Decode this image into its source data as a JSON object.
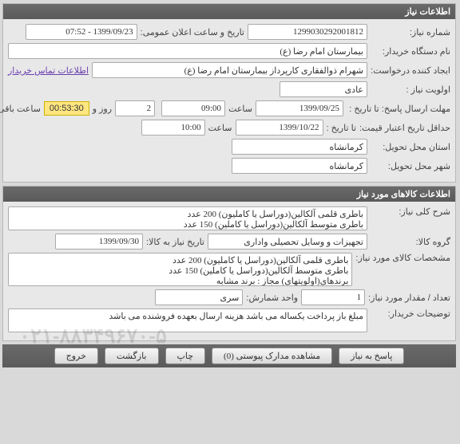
{
  "panels": {
    "need_info": {
      "title": "اطلاعات نیاز",
      "need_number_label": "شماره نیاز:",
      "need_number": "1299030292001812",
      "announce_label": "تاریخ و ساعت اعلان عمومی:",
      "announce_value": "1399/09/23 - 07:52",
      "buyer_label": "نام دستگاه خریدار:",
      "buyer_value": "بیمارستان امام رضا (ع)",
      "requester_label": "ایجاد کننده درخواست:",
      "requester_value": "شهرام ذوالفقاری کارپرداز بیمارستان امام رضا (ع)",
      "contact_link": "اطلاعات تماس خریدار",
      "priority_label": "اولویت نیاز :",
      "priority_value": "عادی",
      "deadline_label": "مهلت ارسال پاسخ:  تا تاریخ :",
      "deadline_date": "1399/09/25",
      "time_label": "ساعت",
      "deadline_time": "09:00",
      "days": "2",
      "days_label": "روز و",
      "countdown": "00:53:30",
      "remain_label": "ساعت باقی مانده",
      "validity_label": "حداقل تاریخ اعتبار قیمت:",
      "validity_sub": "تا تاریخ :",
      "validity_date": "1399/10/22",
      "validity_time": "10:00",
      "delivery_province_label": "استان محل تحویل:",
      "delivery_province": "کرمانشاه",
      "delivery_city_label": "شهر محل تحویل:",
      "delivery_city": "کرمانشاه"
    },
    "goods": {
      "title": "اطلاعات کالاهای مورد نیاز",
      "desc_label": "شرح کلی نیاز:",
      "desc_value": "باطری قلمی آلکالین(دوراسل یا کاملیون) 200 عدد\nباطری متوسط آلکالین(دوراسل یا کاملین) 150 عدد",
      "group_label": "گروه کالا:",
      "group_value": "تجهیزات و وسایل تحصیلی واداری",
      "need_date_label": "تاریخ نیاز به کالا:",
      "need_date": "1399/09/30",
      "spec_label": "مشخصات کالای مورد نیاز:",
      "spec_value": "باطری قلمی آلکالین(دوراسل یا کاملیون) 200 عدد\nباطری متوسط آلکالین(دوراسل یا کاملین) 150 عدد",
      "brand_placeholder": "برندهای(اولویتهای) مجاز : برند مشابه",
      "qty_label": "تعداد / مقدار مورد نیاز:",
      "qty_value": "1",
      "unit_label": "واحد شمارش:",
      "unit_value": "سری",
      "notes_label": "توضیحات خریدار:",
      "notes_value": "مبلغ باز پرداخت یکساله می باشد هزینه ارسال بعهده فروشنده می باشد"
    }
  },
  "watermark": "۰۲۱-۸۸۳۴۹۶۷۰-۵",
  "footer": {
    "respond": "پاسخ به نیاز",
    "attachments": "مشاهده مدارک پیوستی  (0)",
    "print": "چاپ",
    "back": "بازگشت",
    "exit": "خروج"
  }
}
